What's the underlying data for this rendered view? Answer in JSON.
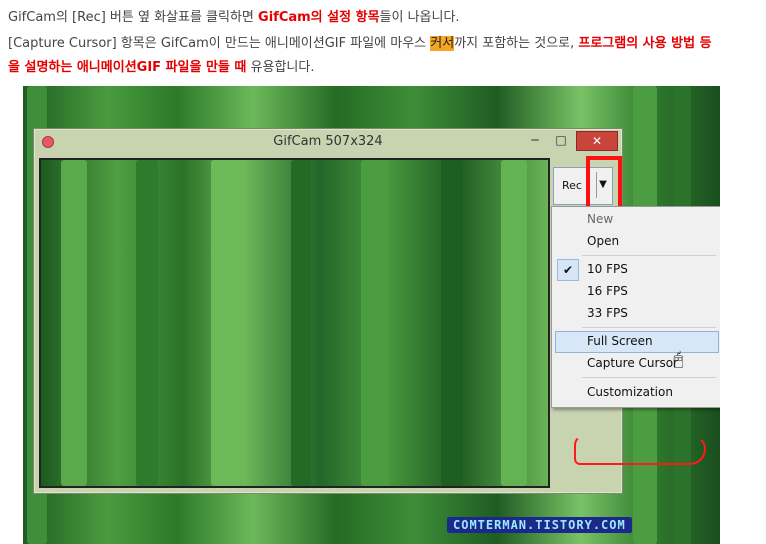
{
  "article": {
    "line1": {
      "a": "GifCam의 [Rec] 버튼 옆 화살표를 클릭하면 ",
      "b": "GifCam의 설정 항목",
      "c": "들이 나옵니다."
    },
    "line2": {
      "a": "[Capture Cursor] 항목은 GifCam이 만드는 애니메이션GIF 파일에 마우스 ",
      "b": "커서",
      "c": "까지 포함하는 것으로, ",
      "d": "프로그램의 사용 방법 등"
    },
    "line3": {
      "a": "을 설명하는 애니메이션GIF 파일을 만들 때",
      "b": " 유용합니다."
    }
  },
  "window": {
    "title": "GifCam 507x324",
    "min_glyph": "─",
    "max_glyph": "□",
    "close_glyph": "✕"
  },
  "rec_button": {
    "label": "Rec",
    "arrow": "▼"
  },
  "menu": {
    "items": [
      "New",
      "Open",
      "10 FPS",
      "16 FPS",
      "33 FPS",
      "Full Screen",
      "Capture Cursor",
      "Customization"
    ],
    "checked_item": "10 FPS",
    "hovered_item": "Full Screen",
    "check_glyph": "✔"
  },
  "watermark": "COMTERMAN.TISTORY.COM",
  "colors": {
    "emphasis_red": "#e60000",
    "highlight_orange": "#f5a623",
    "annotation_red": "#ff1010"
  }
}
